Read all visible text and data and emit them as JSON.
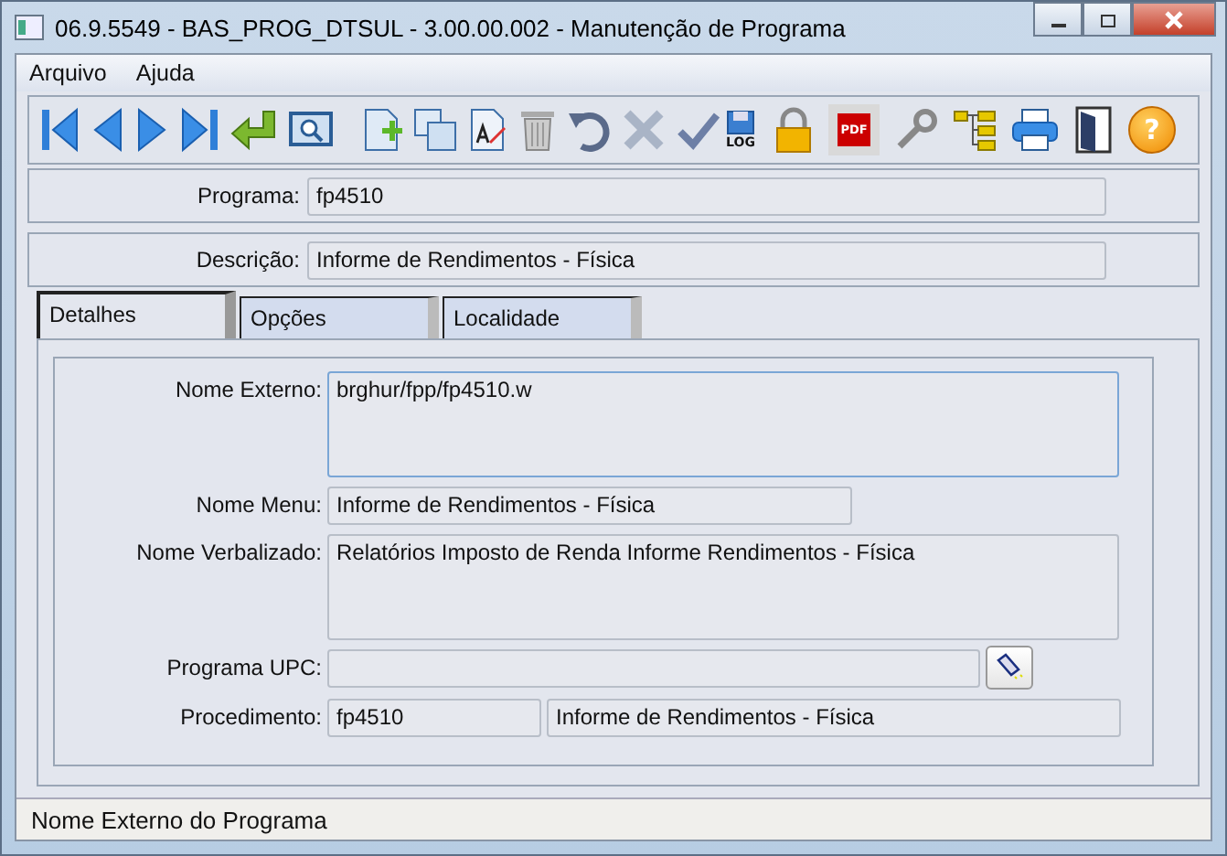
{
  "window": {
    "title": "06.9.5549 - BAS_PROG_DTSUL - 3.00.00.002 - Manutenção de Programa"
  },
  "menu": [
    "Arquivo",
    "Ajuda"
  ],
  "toolbar": {
    "log_label": "LOG",
    "pdf_label": "PDF",
    "help_label": "?"
  },
  "header_fields": [
    {
      "label": "Programa:",
      "value": "fp4510"
    },
    {
      "label": "Descrição:",
      "value": "Informe de Rendimentos - Física"
    }
  ],
  "tabs": [
    {
      "label": "Detalhes",
      "selected": true
    },
    {
      "label": "Opções",
      "selected": false
    },
    {
      "label": "Localidade",
      "selected": false
    }
  ],
  "details": {
    "nome_externo": {
      "label": "Nome Externo:",
      "value": "brghur/fpp/fp4510.w"
    },
    "nome_menu": {
      "label": "Nome Menu:",
      "value": "Informe de Rendimentos - Física"
    },
    "nome_verbalizado": {
      "label": "Nome Verbalizado:",
      "value": "Relatórios Imposto de Renda Informe Rendimentos - Física"
    },
    "programa_upc": {
      "label": "Programa UPC:"
    },
    "procedimento": {
      "label": "Procedimento:",
      "code": "fp4510",
      "description": "Informe de Rendimentos - Física"
    }
  },
  "status_bar": {
    "text": "Nome Externo do Programa"
  }
}
